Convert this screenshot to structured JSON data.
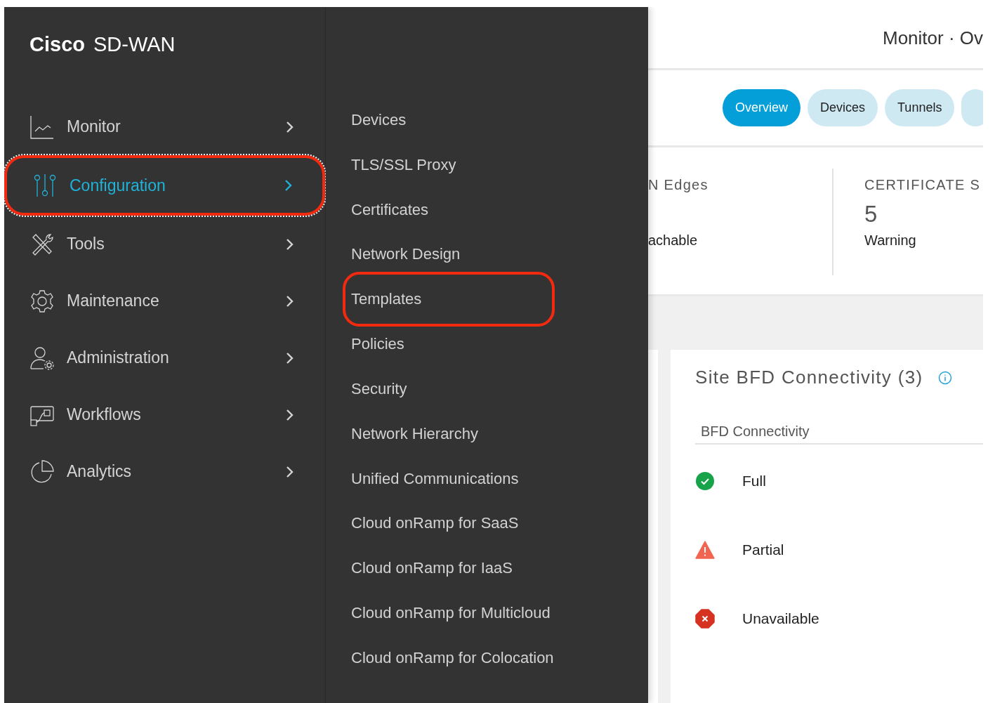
{
  "brand": {
    "name": "Cisco",
    "product": "SD-WAN"
  },
  "nav": [
    {
      "label": "Monitor",
      "kind": "chart",
      "selected": false,
      "highlighted": false
    },
    {
      "label": "Configuration",
      "kind": "sliders",
      "selected": true,
      "highlighted": true
    },
    {
      "label": "Tools",
      "kind": "tools",
      "selected": false,
      "highlighted": false
    },
    {
      "label": "Maintenance",
      "kind": "gear",
      "selected": false,
      "highlighted": false
    },
    {
      "label": "Administration",
      "kind": "usergear",
      "selected": false,
      "highlighted": false
    },
    {
      "label": "Workflows",
      "kind": "workflow",
      "selected": false,
      "highlighted": false
    },
    {
      "label": "Analytics",
      "kind": "pie",
      "selected": false,
      "highlighted": false
    }
  ],
  "submenu": [
    {
      "label": "Devices",
      "highlighted": false
    },
    {
      "label": "TLS/SSL Proxy",
      "highlighted": false
    },
    {
      "label": "Certificates",
      "highlighted": false
    },
    {
      "label": "Network Design",
      "highlighted": false
    },
    {
      "label": "Templates",
      "highlighted": true
    },
    {
      "label": "Policies",
      "highlighted": false
    },
    {
      "label": "Security",
      "highlighted": false
    },
    {
      "label": "Network Hierarchy",
      "highlighted": false
    },
    {
      "label": "Unified Communications",
      "highlighted": false
    },
    {
      "label": "Cloud onRamp for SaaS",
      "highlighted": false
    },
    {
      "label": "Cloud onRamp for IaaS",
      "highlighted": false
    },
    {
      "label": "Cloud onRamp for Multicloud",
      "highlighted": false
    },
    {
      "label": "Cloud onRamp for Colocation",
      "highlighted": false
    }
  ],
  "page_title": "Monitor · Ov",
  "tabs": [
    {
      "label": "Overview",
      "selected": true
    },
    {
      "label": "Devices",
      "selected": false
    },
    {
      "label": "Tunnels",
      "selected": false
    }
  ],
  "stats": [
    {
      "title": "N Edges",
      "status": "achable"
    },
    {
      "title": "CERTIFICATE S",
      "value": "5",
      "status": "Warning"
    }
  ],
  "card": {
    "title": "Site BFD Connectivity (3)",
    "column": "BFD Connectivity",
    "rows": [
      {
        "kind": "full",
        "label": "Full"
      },
      {
        "kind": "partial",
        "label": "Partial"
      },
      {
        "kind": "unavailable",
        "label": "Unavailable"
      }
    ]
  }
}
